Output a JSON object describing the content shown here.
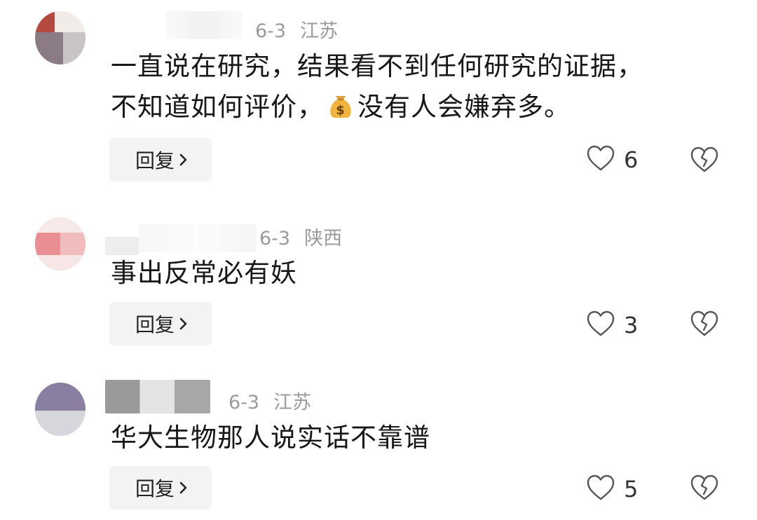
{
  "comments": [
    {
      "date": "6-3",
      "location": "江苏",
      "text_line1": "一直说在研究，结果看不到任何研究的证据，",
      "text_line2_before_icon": "不知道如何评价，",
      "text_icon": "money-bag-icon",
      "text_line2_after_icon": "没有人会嫌弃多。",
      "reply_label": "回复",
      "like_count": "6"
    },
    {
      "date": "6-3",
      "location": "陕西",
      "text": "事出反常必有妖",
      "reply_label": "回复",
      "like_count": "3"
    },
    {
      "date": "6-3",
      "location": "江苏",
      "text": "华大生物那人说实话不靠谱",
      "reply_label": "回复",
      "like_count": "5"
    }
  ],
  "colors": {
    "meta_text": "#9b9b9b",
    "reply_bg": "#f3f3f3",
    "icon_stroke": "#555555"
  }
}
